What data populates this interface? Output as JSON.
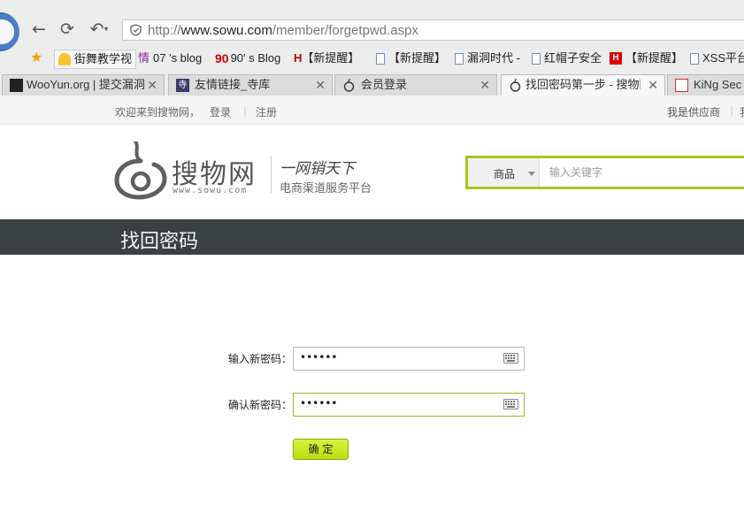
{
  "browser": {
    "url_prefix": "http://",
    "url_domain": "www.sowu.com",
    "url_path": "/member/forgetpwd.aspx",
    "bookmarks": [
      {
        "label": "街舞教学视"
      },
      {
        "label": "07 's blog"
      },
      {
        "label": "90' s Blog"
      },
      {
        "label": "【新提醒】"
      },
      {
        "label": "【新提醒】"
      },
      {
        "label": "漏洞时代 -"
      },
      {
        "label": "红帽子安全"
      },
      {
        "label": "【新提醒】"
      },
      {
        "label": "XSS平台"
      }
    ],
    "tabs": [
      {
        "label": "WooYun.org | 提交漏洞"
      },
      {
        "label": "友情链接_寺库"
      },
      {
        "label": "会员登录"
      },
      {
        "label": "找回密码第一步 - 搜物网"
      },
      {
        "label": "KiNg Sec -"
      }
    ]
  },
  "topbar": {
    "welcome": "欢迎来到搜物网，",
    "login": "登录",
    "separator": "|",
    "register": "注册",
    "supplier": "我是供应商",
    "more": "我"
  },
  "header": {
    "logo_text": "搜物网",
    "logo_domain": "www.sowu.com",
    "slogan": "一网销天下",
    "tagline": "电商渠道服务平台",
    "search_category": "商品",
    "search_placeholder": "输入关键字"
  },
  "page_title": "找回密码",
  "form": {
    "new_password_label": "输入新密码：",
    "new_password_value": "••••••",
    "confirm_password_label": "确认新密码：",
    "confirm_password_value": "••••••",
    "submit_label": "确定"
  }
}
